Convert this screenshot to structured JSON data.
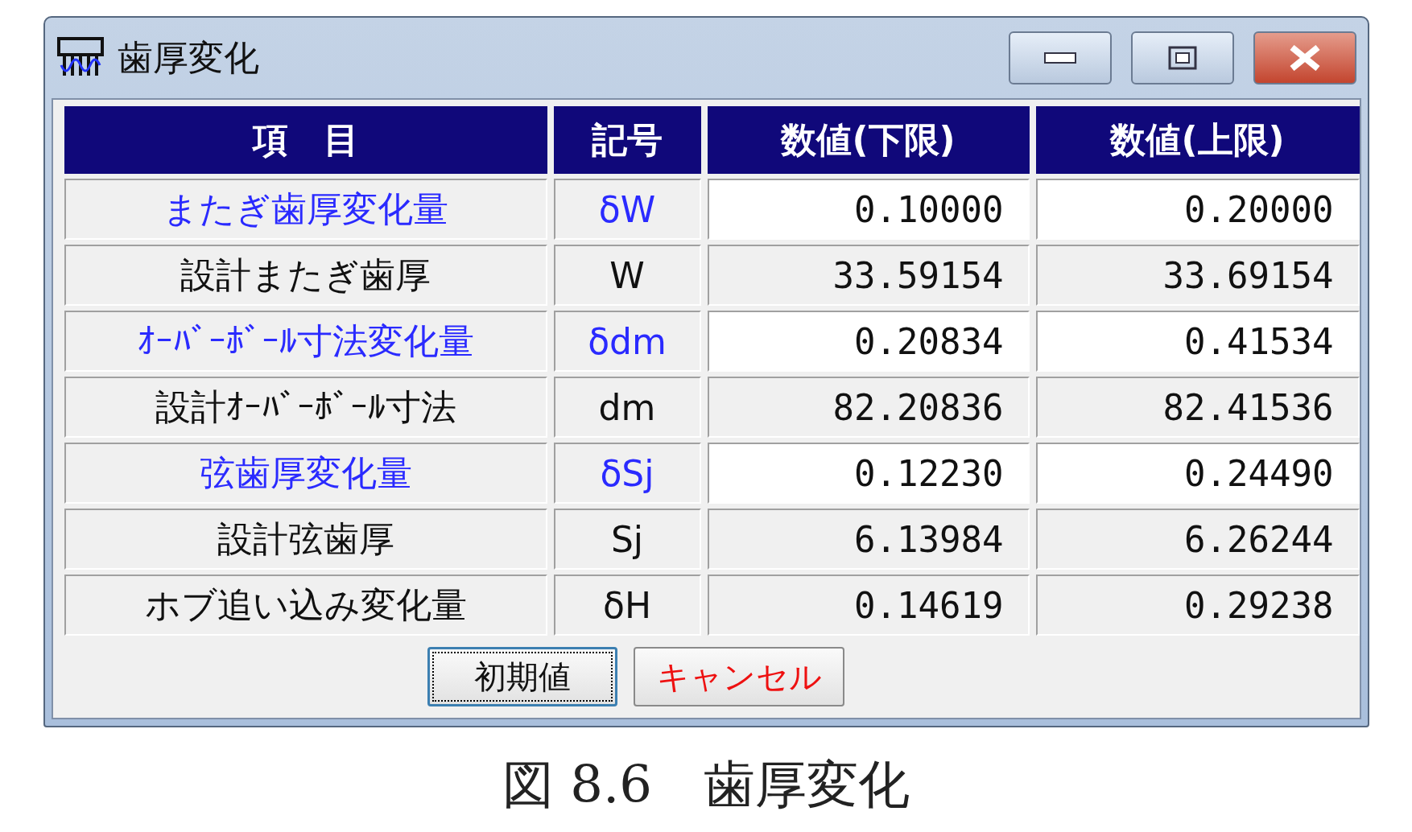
{
  "window": {
    "title": "歯厚変化",
    "controls": [
      {
        "kind": "minimize"
      },
      {
        "kind": "maximize"
      },
      {
        "kind": "close"
      }
    ]
  },
  "table": {
    "columns": [
      "項　目",
      "記号",
      "数値(下限)",
      "数値(上限)"
    ],
    "rows": [
      {
        "kind": "change",
        "item": "またぎ歯厚変化量",
        "symbol": "δW",
        "lower": "0.10000",
        "upper": "0.20000"
      },
      {
        "kind": "design",
        "item": "設計またぎ歯厚",
        "symbol": "W",
        "lower": "33.59154",
        "upper": "33.69154"
      },
      {
        "kind": "change",
        "item": "ｵｰﾊﾞｰﾎﾞｰﾙ寸法変化量",
        "symbol": "δdm",
        "lower": "0.20834",
        "upper": "0.41534"
      },
      {
        "kind": "design",
        "item": "設計ｵｰﾊﾞｰﾎﾞｰﾙ寸法",
        "symbol": "dm",
        "lower": "82.20836",
        "upper": "82.41536"
      },
      {
        "kind": "change",
        "item": "弦歯厚変化量",
        "symbol": "δSj",
        "lower": "0.12230",
        "upper": "0.24490"
      },
      {
        "kind": "design",
        "item": "設計弦歯厚",
        "symbol": "Sj",
        "lower": "6.13984",
        "upper": "6.26244"
      },
      {
        "kind": "design",
        "item": "ホブ追い込み変化量",
        "symbol": "δH",
        "lower": "0.14619",
        "upper": "0.29238"
      }
    ]
  },
  "buttons": [
    {
      "label": "初期値",
      "kind": "default",
      "focused": true
    },
    {
      "label": "キャンセル",
      "kind": "cancel",
      "focused": false
    }
  ],
  "caption": "図 8.6　歯厚変化"
}
